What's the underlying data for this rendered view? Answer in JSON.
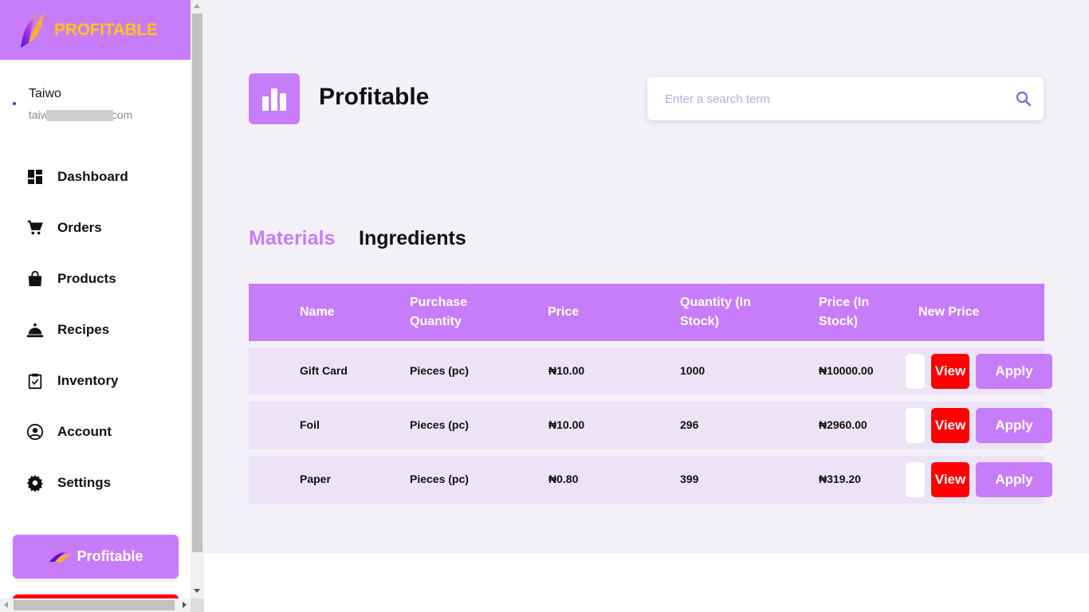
{
  "brand": {
    "name": "PROFITABLE",
    "logo_icon": "profitable-logo"
  },
  "user": {
    "name": "Taiwo",
    "email": "taiw            291@gmail.com"
  },
  "nav": [
    {
      "label": "Dashboard",
      "icon": "dashboard-icon"
    },
    {
      "label": "Orders",
      "icon": "cart-icon"
    },
    {
      "label": "Products",
      "icon": "bag-icon"
    },
    {
      "label": "Recipes",
      "icon": "cloche-icon"
    },
    {
      "label": "Inventory",
      "icon": "clipboard-check-icon"
    },
    {
      "label": "Account",
      "icon": "account-circle-icon"
    },
    {
      "label": "Settings",
      "icon": "gear-icon"
    }
  ],
  "sidebar_button": {
    "label": "Profitable"
  },
  "header": {
    "title": "Profitable",
    "icon": "bar-chart-icon"
  },
  "search": {
    "placeholder": "Enter a search term",
    "value": ""
  },
  "tabs": [
    {
      "label": "Materials",
      "active": true
    },
    {
      "label": "Ingredients",
      "active": false
    }
  ],
  "table": {
    "columns": [
      "Name",
      "Purchase Quantity",
      "Price",
      "Quantity (In Stock)",
      "Price (In Stock)",
      "New Price"
    ],
    "rows": [
      {
        "name": "Gift Card",
        "purchase_quantity": "Pieces (pc)",
        "price": "₦10.00",
        "quantity_in_stock": "1000",
        "price_in_stock": "₦10000.00",
        "new_price": ""
      },
      {
        "name": "Foil",
        "purchase_quantity": "Pieces (pc)",
        "price": "₦10.00",
        "quantity_in_stock": "296",
        "price_in_stock": "₦2960.00",
        "new_price": ""
      },
      {
        "name": "Paper",
        "purchase_quantity": "Pieces (pc)",
        "price": "₦0.80",
        "quantity_in_stock": "399",
        "price_in_stock": "₦319.20",
        "new_price": ""
      }
    ],
    "view_label": "View",
    "apply_label": "Apply"
  },
  "colors": {
    "accent": "#c77dfa",
    "brand_text": "#ffc21a",
    "danger": "#ff0000",
    "row_bg": "#ebe3f6",
    "main_bg": "#f3f1f7"
  }
}
